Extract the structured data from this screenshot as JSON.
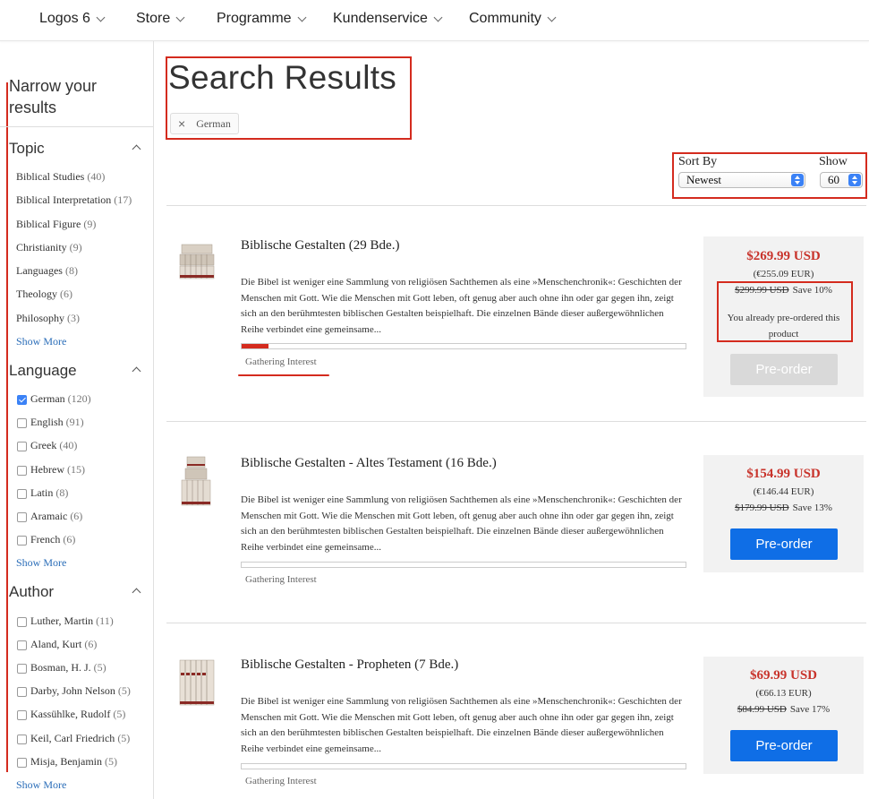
{
  "nav": {
    "items": [
      "Logos 6",
      "Store",
      "Programme",
      "Kundenservice",
      "Community"
    ]
  },
  "sidebar": {
    "heading": "Narrow your results",
    "topic": {
      "title": "Topic",
      "items": [
        {
          "label": "Biblical Studies",
          "count": "(40)"
        },
        {
          "label": "Biblical Interpretation",
          "count": "(17)"
        },
        {
          "label": "Biblical Figure",
          "count": "(9)"
        },
        {
          "label": "Christianity",
          "count": "(9)"
        },
        {
          "label": "Languages",
          "count": "(8)"
        },
        {
          "label": "Theology",
          "count": "(6)"
        },
        {
          "label": "Philosophy",
          "count": "(3)"
        }
      ],
      "show_more": "Show More"
    },
    "language": {
      "title": "Language",
      "items": [
        {
          "label": "German",
          "count": "(120)",
          "checked": true
        },
        {
          "label": "English",
          "count": "(91)",
          "checked": false
        },
        {
          "label": "Greek",
          "count": "(40)",
          "checked": false
        },
        {
          "label": "Hebrew",
          "count": "(15)",
          "checked": false
        },
        {
          "label": "Latin",
          "count": "(8)",
          "checked": false
        },
        {
          "label": "Aramaic",
          "count": "(6)",
          "checked": false
        },
        {
          "label": "French",
          "count": "(6)",
          "checked": false
        }
      ],
      "show_more": "Show More"
    },
    "author": {
      "title": "Author",
      "items": [
        {
          "label": "Luther, Martin",
          "count": "(11)",
          "checked": false
        },
        {
          "label": "Aland, Kurt",
          "count": "(6)",
          "checked": false
        },
        {
          "label": "Bosman, H. J.",
          "count": "(5)",
          "checked": false
        },
        {
          "label": "Darby, John Nelson",
          "count": "(5)",
          "checked": false
        },
        {
          "label": "Kassühlke, Rudolf",
          "count": "(5)",
          "checked": false
        },
        {
          "label": "Keil, Carl Friedrich",
          "count": "(5)",
          "checked": false
        },
        {
          "label": "Misja, Benjamin",
          "count": "(5)",
          "checked": false
        }
      ],
      "show_more": "Show More"
    }
  },
  "header": {
    "title": "Search Results",
    "chip_label": "German",
    "chip_remove": "×"
  },
  "sort": {
    "sort_by_label": "Sort By",
    "sort_by_value": "Newest",
    "show_label": "Show",
    "show_value": "60"
  },
  "products": [
    {
      "title": "Biblische Gestalten (29 Bde.)",
      "description": "Die Bibel ist weniger eine Sammlung von religiösen Sachthemen als eine »Menschenchronik«: Geschichten der Menschen mit Gott. Wie die Menschen mit Gott leben, oft genug aber auch ohne ihn oder gar gegen ihn, zeigt sich an den berühmtesten biblischen Gestalten beispielhaft. Die einzelnen Bände dieser außergewöhnlichen Reihe verbindet eine gemeinsame...",
      "progress": 0.06,
      "status": "Gathering Interest",
      "price": "$269.99 USD",
      "eur": "(€255.09 EUR)",
      "list_price": "$299.99 USD",
      "save": "Save 10%",
      "note": "You already pre-ordered this product",
      "button": "Pre-order",
      "button_disabled": true
    },
    {
      "title": "Biblische Gestalten - Altes Testament (16 Bde.)",
      "description": "Die Bibel ist weniger eine Sammlung von religiösen Sachthemen als eine »Menschenchronik«: Geschichten der Menschen mit Gott. Wie die Menschen mit Gott leben, oft genug aber auch ohne ihn oder gar gegen ihn, zeigt sich an den berühmtesten biblischen Gestalten beispielhaft. Die einzelnen Bände dieser außergewöhnlichen Reihe verbindet eine gemeinsame...",
      "progress": 0,
      "status": "Gathering Interest",
      "price": "$154.99 USD",
      "eur": "(€146.44 EUR)",
      "list_price": "$179.99 USD",
      "save": "Save 13%",
      "button": "Pre-order",
      "button_disabled": false
    },
    {
      "title": "Biblische Gestalten - Propheten (7 Bde.)",
      "description": "Die Bibel ist weniger eine Sammlung von religiösen Sachthemen als eine »Menschenchronik«: Geschichten der Menschen mit Gott. Wie die Menschen mit Gott leben, oft genug aber auch ohne ihn oder gar gegen ihn, zeigt sich an den berühmtesten biblischen Gestalten beispielhaft. Die einzelnen Bände dieser außergewöhnlichen Reihe verbindet eine gemeinsame...",
      "progress": 0,
      "status": "Gathering Interest",
      "price": "$69.99 USD",
      "eur": "(€66.13 EUR)",
      "list_price": "$84.99 USD",
      "save": "Save 17%",
      "button": "Pre-order",
      "button_disabled": false
    }
  ],
  "colors": {
    "accent_red": "#d42b1e",
    "price_red": "#c8332b",
    "button_blue": "#0f6ee6",
    "link_blue": "#2a6db8"
  }
}
